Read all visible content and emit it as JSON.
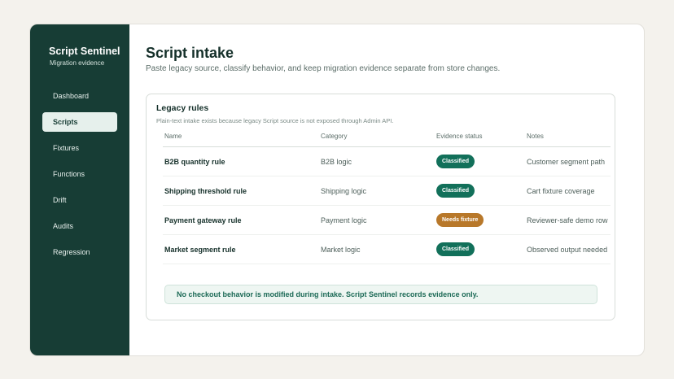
{
  "sidebar": {
    "title": "Script Sentinel",
    "subtitle": "Migration evidence",
    "items": [
      {
        "label": "Dashboard"
      },
      {
        "label": "Scripts"
      },
      {
        "label": "Fixtures"
      },
      {
        "label": "Functions"
      },
      {
        "label": "Drift"
      },
      {
        "label": "Audits"
      },
      {
        "label": "Regression"
      }
    ],
    "active": "Scripts"
  },
  "page": {
    "title": "Script intake",
    "subtitle": "Paste legacy source, classify behavior, and keep migration evidence separate from store changes."
  },
  "card": {
    "title": "Legacy rules",
    "subtitle": "Plain-text intake exists because legacy Script source is not exposed through Admin API.",
    "columns": [
      "Name",
      "Category",
      "Evidence status",
      "Notes"
    ],
    "rows": [
      {
        "name": "B2B quantity rule",
        "category": "B2B logic",
        "status": "Classified",
        "notes": "Customer segment path"
      },
      {
        "name": "Shipping threshold rule",
        "category": "Shipping logic",
        "status": "Classified",
        "notes": "Cart fixture coverage"
      },
      {
        "name": "Payment gateway rule",
        "category": "Payment logic",
        "status": "Needs fixture",
        "notes": "Reviewer-safe demo row"
      },
      {
        "name": "Market segment rule",
        "category": "Market logic",
        "status": "Classified",
        "notes": "Observed output needed"
      }
    ],
    "notice": "No checkout behavior is modified during intake. Script Sentinel records evidence only."
  },
  "colors": {
    "sidebar_bg": "#173d35",
    "classified": "#12705a",
    "needs_fixture": "#b8782a",
    "notice_bg": "#eef6f2"
  }
}
